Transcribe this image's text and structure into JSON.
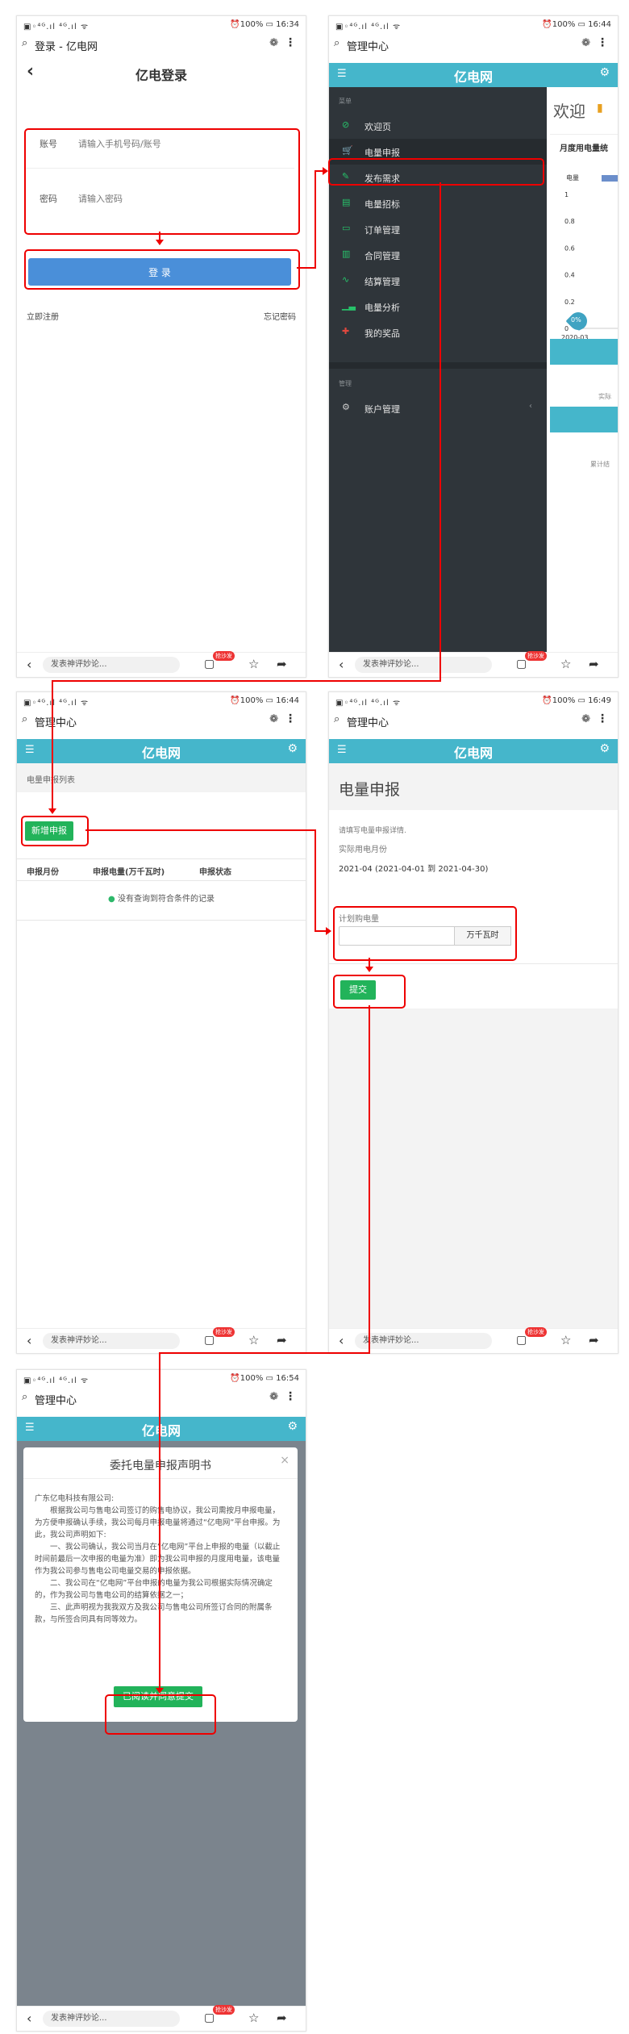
{
  "status_bar": {
    "signal": "▣◦⁴ᴳ.ıl ⁴ᴳ.ıl ᯤ",
    "battery": "100%"
  },
  "times": {
    "p1": "16:34",
    "p2": "16:44",
    "p3": "16:44",
    "p4": "16:49",
    "p5": "16:54"
  },
  "bottom_bar": {
    "comment_placeholder": "发表神评妙论...",
    "badge": "抢沙发"
  },
  "login": {
    "tab_title": "登录 - 亿电网",
    "title": "亿电登录",
    "account_label": "账号",
    "account_placeholder": "请输入手机号码/账号",
    "password_label": "密码",
    "password_placeholder": "请输入密码",
    "login_button": "登 录",
    "register_link": "立即注册",
    "forgot_link": "忘记密码"
  },
  "admin": {
    "tab_title": "管理中心",
    "brand": "亿电网"
  },
  "sidebar": {
    "section_menu": "菜单",
    "items": [
      "欢迎页",
      "电量申报",
      "发布需求",
      "电量招标",
      "订单管理",
      "合同管理",
      "结算管理",
      "电量分析",
      "我的奖品"
    ],
    "section_manage": "管理",
    "manage_item": "账户管理"
  },
  "welcome": {
    "heading": "欢迎",
    "chart_title": "月度用电量统",
    "legend": "电量",
    "y_ticks": [
      "1",
      "0.8",
      "0.6",
      "0.4",
      "0.2",
      "0"
    ],
    "x_tick": "2020-03",
    "marker": "0%",
    "label_actual": "实际",
    "label_cumulative": "累计结"
  },
  "chart_data": {
    "type": "line",
    "x": [
      "2020-03"
    ],
    "values": [
      0
    ],
    "ylabel": "电量",
    "ylim": [
      0,
      1
    ]
  },
  "report_list": {
    "section_title": "电量申报列表",
    "add_button": "新增申报",
    "columns": [
      "申报月份",
      "申报电量(万千瓦时)",
      "申报状态"
    ],
    "empty_message": "没有查询到符合条件的记录"
  },
  "report_form": {
    "title": "电量申报",
    "hint": "请填写电量申报详情.",
    "month_label": "实际用电月份",
    "month_value": "2021-04 (2021-04-01 到 2021-04-30)",
    "plan_label": "计划购电量",
    "plan_unit": "万千瓦时",
    "submit_button": "提交"
  },
  "modal": {
    "title": "委托电量申报声明书",
    "close": "×",
    "salutation": "广东亿电科技有限公司:",
    "para1": "根据我公司与售电公司签订的购售电协议，我公司需按月申报电量，为方便申报确认手续，我公司每月申报电量将通过“亿电网”平台申报。为此，我公司声明如下:",
    "item1": "一、我公司确认，我公司当月在“亿电网”平台上申报的电量（以截止时间前最后一次申报的电量为准）即为我公司申报的月度用电量，该电量作为我公司参与售电公司电量交易的申报依据。",
    "item2": "二、我公司在“亿电网”平台申报的电量为我公司根据实际情况确定的，作为我公司与售电公司的结算依据之一；",
    "item3": "三、此声明视为我我双方及我公司与售电公司所签订合同的附属条款，与所签合同具有同等效力。",
    "agree_button": "已阅读并同意提交"
  }
}
